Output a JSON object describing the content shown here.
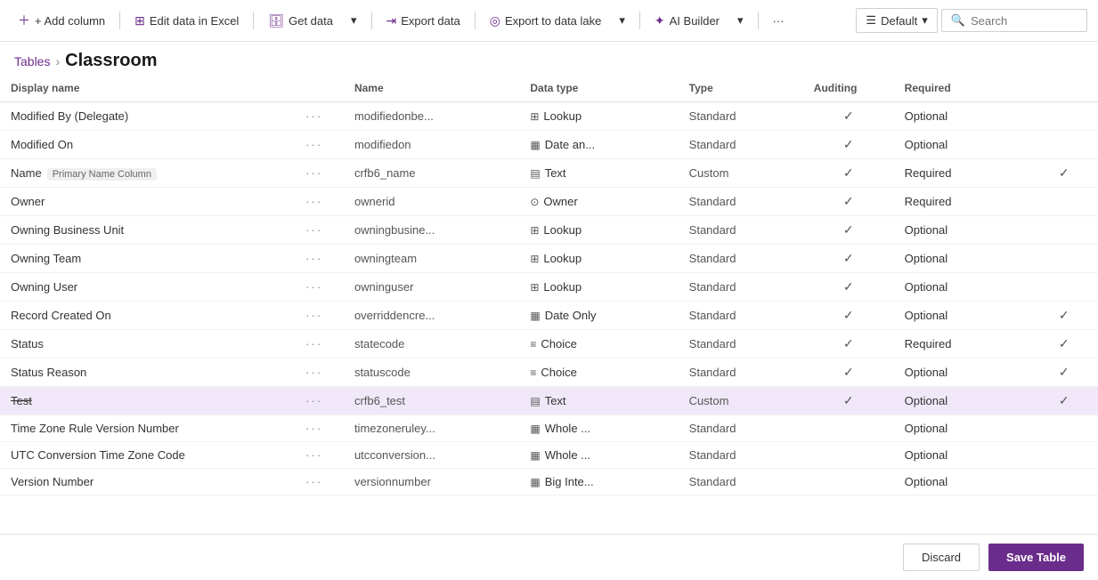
{
  "toolbar": {
    "add_column": "+ Add column",
    "edit_excel": "Edit data in Excel",
    "get_data": "Get data",
    "export_data": "Export data",
    "export_lake": "Export to data lake",
    "ai_builder": "AI Builder",
    "more": "···",
    "default_label": "Default",
    "search_placeholder": "Search"
  },
  "breadcrumb": {
    "parent": "Tables",
    "separator": "›",
    "current": "Classroom"
  },
  "table": {
    "columns": [
      "Display name",
      "",
      "Name",
      "Data type",
      "Type",
      "Auditing",
      "Required",
      ""
    ],
    "rows": [
      {
        "name": "Modified By (Delegate)",
        "dots": "···",
        "logname": "modifiedonbe...",
        "type_icon": "🔗",
        "type": "Lookup",
        "custom": "Standard",
        "auditing": true,
        "required": "Optional",
        "managed": false,
        "selected": false,
        "strikethrough": false,
        "badge": ""
      },
      {
        "name": "Modified On",
        "dots": "···",
        "logname": "modifiedon",
        "type_icon": "📅",
        "type": "Date an...",
        "custom": "Standard",
        "auditing": true,
        "required": "Optional",
        "managed": false,
        "selected": false,
        "strikethrough": false,
        "badge": ""
      },
      {
        "name": "Name",
        "dots": "···",
        "logname": "crfb6_name",
        "type_icon": "📝",
        "type": "Text",
        "custom": "Custom",
        "auditing": true,
        "required": "Required",
        "managed": true,
        "selected": false,
        "strikethrough": false,
        "badge": "Primary Name Column"
      },
      {
        "name": "Owner",
        "dots": "···",
        "logname": "ownerid",
        "type_icon": "👤",
        "type": "Owner",
        "custom": "Standard",
        "auditing": true,
        "required": "Required",
        "managed": false,
        "selected": false,
        "strikethrough": false,
        "badge": ""
      },
      {
        "name": "Owning Business Unit",
        "dots": "···",
        "logname": "owningbusine...",
        "type_icon": "🔗",
        "type": "Lookup",
        "custom": "Standard",
        "auditing": true,
        "required": "Optional",
        "managed": false,
        "selected": false,
        "strikethrough": false,
        "badge": ""
      },
      {
        "name": "Owning Team",
        "dots": "···",
        "logname": "owningteam",
        "type_icon": "🔗",
        "type": "Lookup",
        "custom": "Standard",
        "auditing": true,
        "required": "Optional",
        "managed": false,
        "selected": false,
        "strikethrough": false,
        "badge": ""
      },
      {
        "name": "Owning User",
        "dots": "···",
        "logname": "owninguser",
        "type_icon": "🔗",
        "type": "Lookup",
        "custom": "Standard",
        "auditing": true,
        "required": "Optional",
        "managed": false,
        "selected": false,
        "strikethrough": false,
        "badge": ""
      },
      {
        "name": "Record Created On",
        "dots": "···",
        "logname": "overriddencre...",
        "type_icon": "📅",
        "type": "Date Only",
        "custom": "Standard",
        "auditing": true,
        "required": "Optional",
        "managed": true,
        "selected": false,
        "strikethrough": false,
        "badge": ""
      },
      {
        "name": "Status",
        "dots": "···",
        "logname": "statecode",
        "type_icon": "≡",
        "type": "Choice",
        "custom": "Standard",
        "auditing": true,
        "required": "Required",
        "managed": true,
        "selected": false,
        "strikethrough": false,
        "badge": ""
      },
      {
        "name": "Status Reason",
        "dots": "···",
        "logname": "statuscode",
        "type_icon": "≡",
        "type": "Choice",
        "custom": "Standard",
        "auditing": true,
        "required": "Optional",
        "managed": true,
        "selected": false,
        "strikethrough": false,
        "badge": ""
      },
      {
        "name": "Test",
        "dots": "···",
        "logname": "crfb6_test",
        "type_icon": "📝",
        "type": "Text",
        "custom": "Custom",
        "auditing": true,
        "required": "Optional",
        "managed": true,
        "selected": true,
        "strikethrough": true,
        "badge": ""
      },
      {
        "name": "Time Zone Rule Version Number",
        "dots": "···",
        "logname": "timezoneruley...",
        "type_icon": "🔢",
        "type": "Whole ...",
        "custom": "Standard",
        "auditing": false,
        "required": "Optional",
        "managed": false,
        "selected": false,
        "strikethrough": false,
        "badge": ""
      },
      {
        "name": "UTC Conversion Time Zone Code",
        "dots": "···",
        "logname": "utcconversion...",
        "type_icon": "🔢",
        "type": "Whole ...",
        "custom": "Standard",
        "auditing": false,
        "required": "Optional",
        "managed": false,
        "selected": false,
        "strikethrough": false,
        "badge": ""
      },
      {
        "name": "Version Number",
        "dots": "···",
        "logname": "versionnumber",
        "type_icon": "🔢",
        "type": "Big Inte...",
        "custom": "Standard",
        "auditing": false,
        "required": "Optional",
        "managed": false,
        "selected": false,
        "strikethrough": false,
        "badge": ""
      }
    ]
  },
  "footer": {
    "discard": "Discard",
    "save": "Save Table"
  },
  "colors": {
    "accent": "#6b2d8b",
    "selected_row": "#f0e8f8"
  }
}
